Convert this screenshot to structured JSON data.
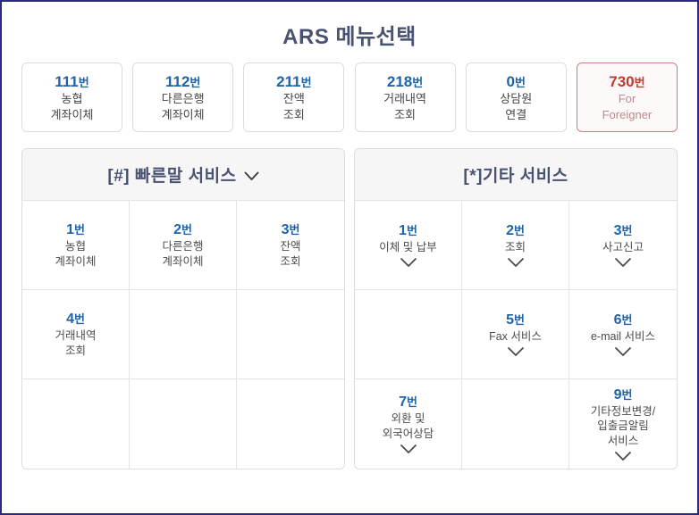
{
  "page": {
    "title": "ARS 메뉴선택",
    "accent_blue": "#1f63ab",
    "accent_red": "#c0392f",
    "title_color": "#4a5272",
    "border_color": "#2b2a80"
  },
  "top_menu": {
    "items": [
      {
        "num": "111",
        "suffix": "번",
        "line1": "농협",
        "line2": "계좌이체",
        "highlight": false
      },
      {
        "num": "112",
        "suffix": "번",
        "line1": "다른은행",
        "line2": "계좌이체",
        "highlight": false
      },
      {
        "num": "211",
        "suffix": "번",
        "line1": "잔액",
        "line2": "조회",
        "highlight": false
      },
      {
        "num": "218",
        "suffix": "번",
        "line1": "거래내역",
        "line2": "조회",
        "highlight": false
      },
      {
        "num": "0",
        "suffix": "번",
        "line1": "상담원",
        "line2": "연결",
        "highlight": false
      },
      {
        "num": "730",
        "suffix": "번",
        "line1": "For",
        "line2": "Foreigner",
        "highlight": true
      }
    ]
  },
  "left_panel": {
    "header": "[#] 빠른말 서비스",
    "header_icon": "chevron-down-icon",
    "has_header_chevron": true,
    "cells": [
      {
        "num": "1",
        "suffix": "번",
        "lines": [
          "농협",
          "계좌이체"
        ],
        "chevron": false
      },
      {
        "num": "2",
        "suffix": "번",
        "lines": [
          "다른은행",
          "계좌이체"
        ],
        "chevron": false
      },
      {
        "num": "3",
        "suffix": "번",
        "lines": [
          "잔액",
          "조회"
        ],
        "chevron": false
      },
      {
        "num": "4",
        "suffix": "번",
        "lines": [
          "거래내역",
          "조회"
        ],
        "chevron": false
      },
      {
        "num": "",
        "suffix": "",
        "lines": [],
        "chevron": false
      },
      {
        "num": "",
        "suffix": "",
        "lines": [],
        "chevron": false
      },
      {
        "num": "",
        "suffix": "",
        "lines": [],
        "chevron": false
      },
      {
        "num": "",
        "suffix": "",
        "lines": [],
        "chevron": false
      },
      {
        "num": "",
        "suffix": "",
        "lines": [],
        "chevron": false
      }
    ]
  },
  "right_panel": {
    "header": "[*]기타 서비스",
    "header_icon": "",
    "has_header_chevron": false,
    "cells": [
      {
        "num": "1",
        "suffix": "번",
        "lines": [
          "이체 및 납부"
        ],
        "chevron": true
      },
      {
        "num": "2",
        "suffix": "번",
        "lines": [
          "조회"
        ],
        "chevron": true
      },
      {
        "num": "3",
        "suffix": "번",
        "lines": [
          "사고신고"
        ],
        "chevron": true
      },
      {
        "num": "",
        "suffix": "",
        "lines": [],
        "chevron": false
      },
      {
        "num": "5",
        "suffix": "번",
        "lines": [
          "Fax 서비스"
        ],
        "chevron": true
      },
      {
        "num": "6",
        "suffix": "번",
        "lines": [
          "e-mail 서비스"
        ],
        "chevron": true
      },
      {
        "num": "7",
        "suffix": "번",
        "lines": [
          "외환 및",
          "외국어상담"
        ],
        "chevron": true
      },
      {
        "num": "",
        "suffix": "",
        "lines": [],
        "chevron": false
      },
      {
        "num": "9",
        "suffix": "번",
        "lines": [
          "기타정보변경/",
          "입출금알림",
          "서비스"
        ],
        "chevron": true
      }
    ]
  }
}
